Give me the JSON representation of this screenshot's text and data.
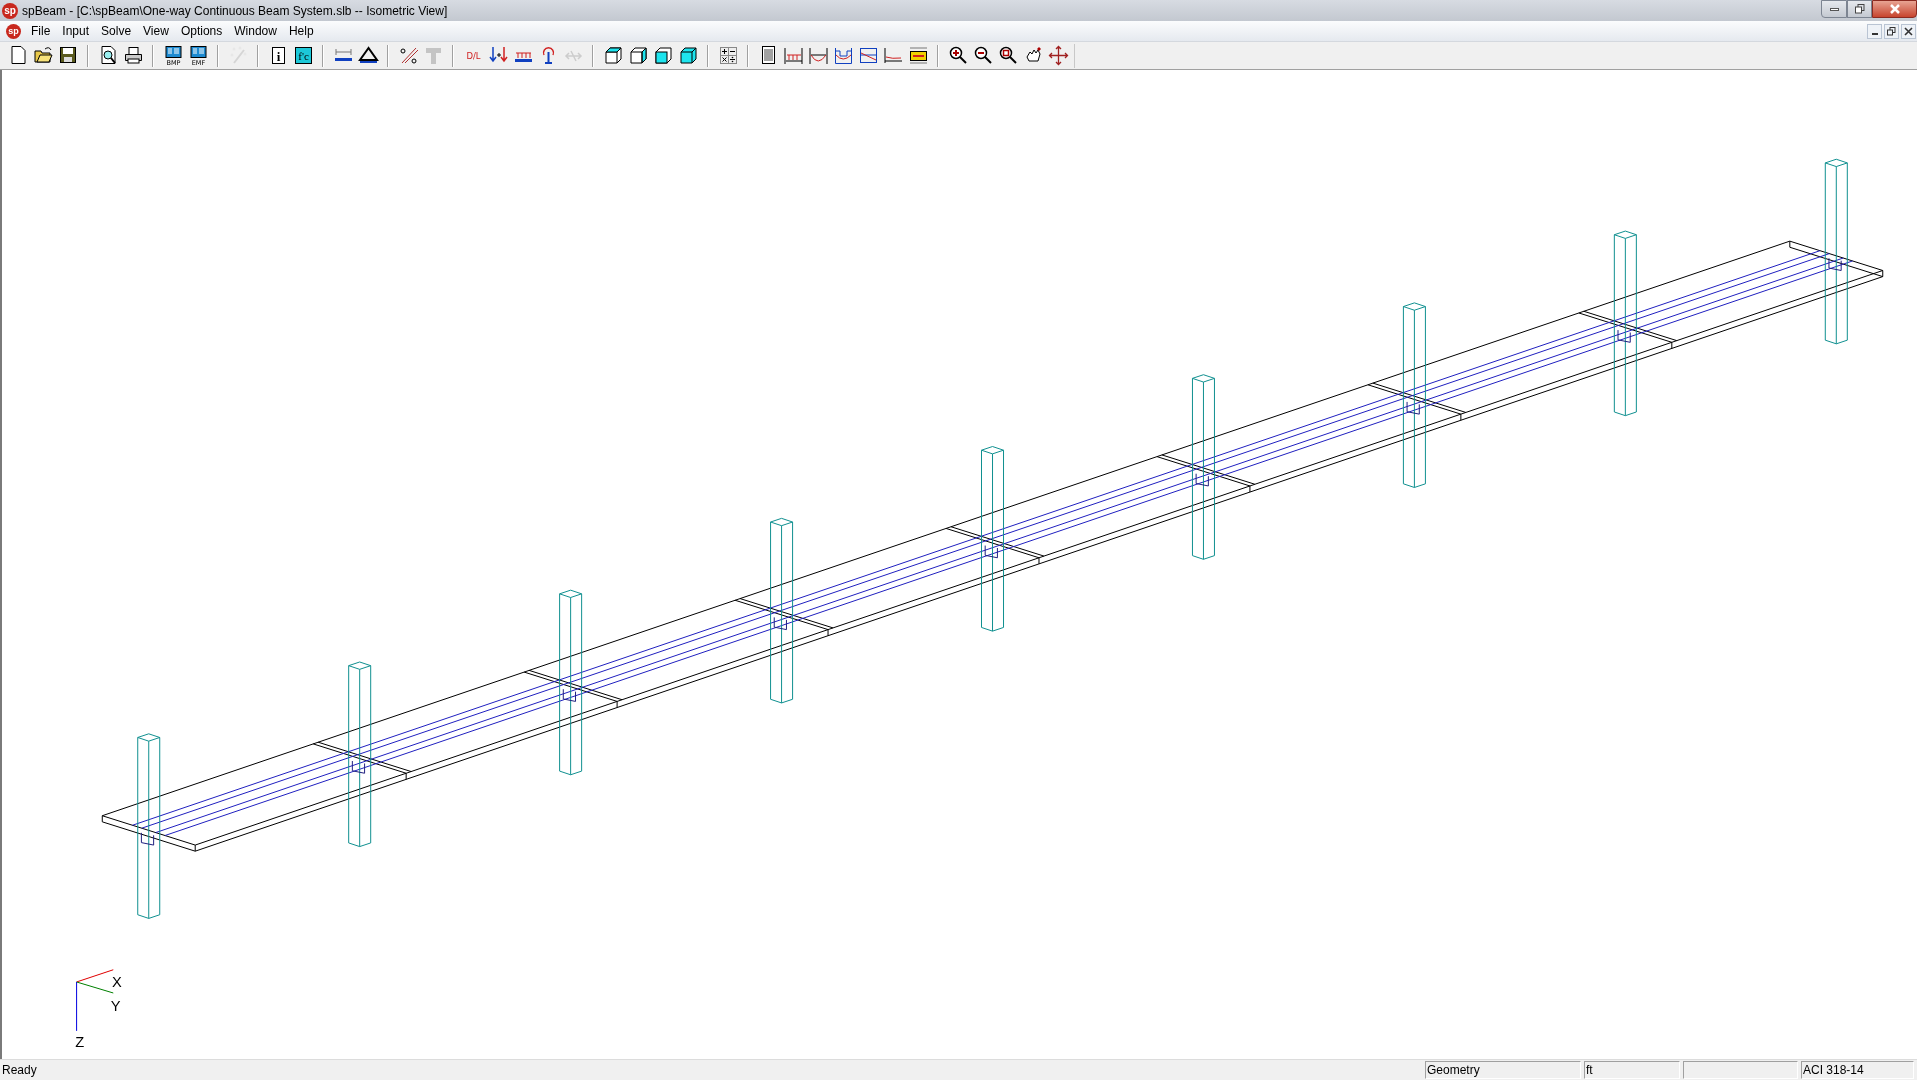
{
  "window": {
    "icon_text": "sp",
    "title": "spBeam - [C:\\spBeam\\One-way Continuous Beam System.slb -- Isometric View]"
  },
  "menu": {
    "icon_text": "sp",
    "items": [
      "File",
      "Input",
      "Solve",
      "View",
      "Options",
      "Window",
      "Help"
    ]
  },
  "toolbar": [
    {
      "kind": "new",
      "disabled": false
    },
    {
      "kind": "open",
      "disabled": false
    },
    {
      "kind": "save",
      "disabled": false
    },
    {
      "kind": "separator"
    },
    {
      "kind": "preview",
      "disabled": false
    },
    {
      "kind": "print",
      "disabled": false
    },
    {
      "kind": "separator"
    },
    {
      "kind": "doc",
      "label": "BMP",
      "disabled": false
    },
    {
      "kind": "doc",
      "label": "EMF",
      "disabled": false
    },
    {
      "kind": "separator"
    },
    {
      "kind": "wizard",
      "disabled": true
    },
    {
      "kind": "separator"
    },
    {
      "kind": "info",
      "label": "i",
      "disabled": false
    },
    {
      "kind": "material",
      "label": "f'c",
      "disabled": false
    },
    {
      "kind": "separator"
    },
    {
      "kind": "span",
      "disabled": false
    },
    {
      "kind": "support",
      "disabled": false
    },
    {
      "kind": "separator"
    },
    {
      "kind": "hatch",
      "disabled": false
    },
    {
      "kind": "tsection",
      "disabled": true
    },
    {
      "kind": "separator"
    },
    {
      "kind": "loadcase",
      "label": "D/L",
      "disabled": false
    },
    {
      "kind": "pointloads",
      "disabled": false
    },
    {
      "kind": "spanload",
      "disabled": false
    },
    {
      "kind": "moment",
      "disabled": false
    },
    {
      "kind": "linked",
      "disabled": true
    },
    {
      "kind": "separator"
    },
    {
      "kind": "cube1",
      "disabled": false
    },
    {
      "kind": "cube2",
      "disabled": false
    },
    {
      "kind": "cube3",
      "disabled": false
    },
    {
      "kind": "cube4",
      "disabled": false
    },
    {
      "kind": "separator"
    },
    {
      "kind": "calc",
      "disabled": false
    },
    {
      "kind": "separator"
    },
    {
      "kind": "report",
      "disabled": false
    },
    {
      "kind": "loaddiag",
      "disabled": false
    },
    {
      "kind": "momentdiag",
      "disabled": false
    },
    {
      "kind": "sheardiag",
      "disabled": false
    },
    {
      "kind": "deflection",
      "disabled": false
    },
    {
      "kind": "reinf",
      "disabled": false
    },
    {
      "kind": "section",
      "disabled": false
    },
    {
      "kind": "separator"
    },
    {
      "kind": "zoomin",
      "disabled": false
    },
    {
      "kind": "zoomout",
      "disabled": false
    },
    {
      "kind": "zoomwin",
      "disabled": false
    },
    {
      "kind": "pan",
      "disabled": false
    },
    {
      "kind": "move",
      "disabled": false
    }
  ],
  "view": {
    "axes": [
      "X",
      "Y",
      "Z"
    ]
  },
  "status_bar": {
    "message": "Ready",
    "panes": [
      "Geometry",
      "ft"
    ],
    "code": "ACI 318-14"
  }
}
